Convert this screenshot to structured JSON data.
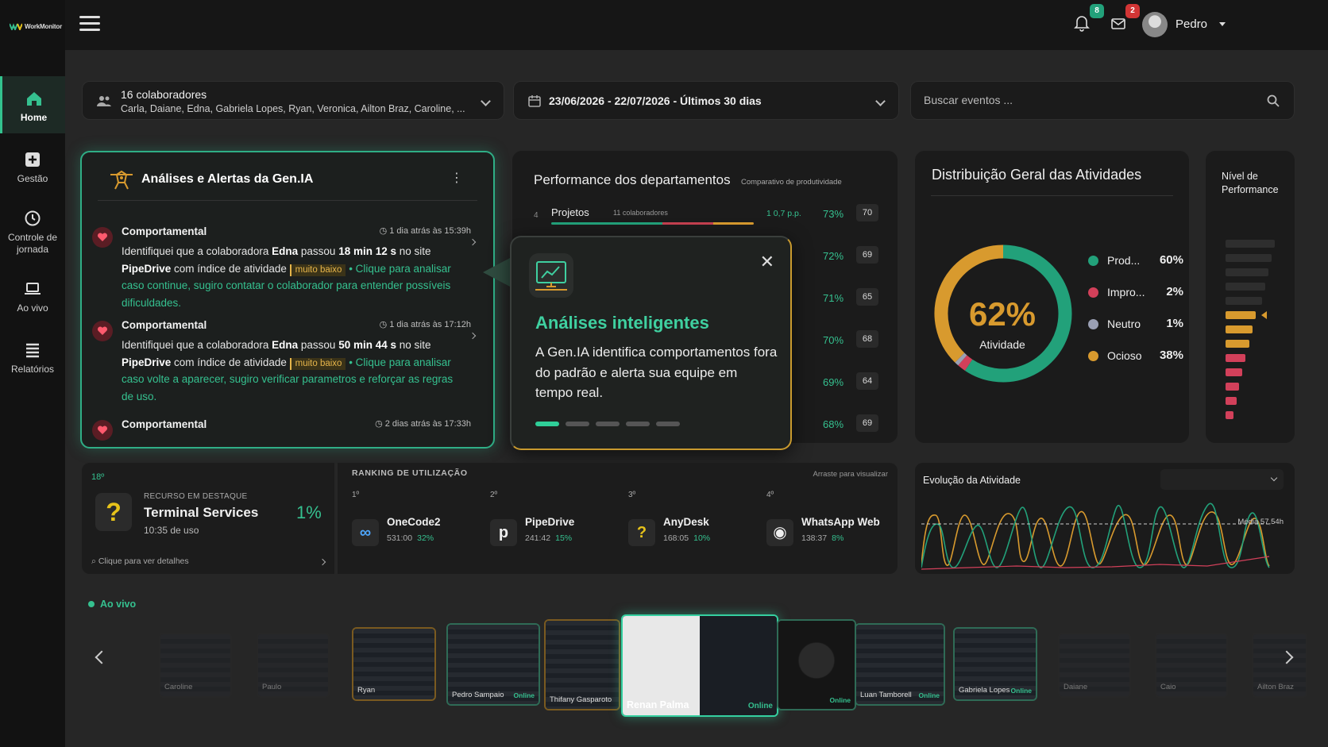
{
  "app": {
    "logo_text": "WorkMonitor"
  },
  "sidebar": {
    "items": [
      {
        "label": "Home",
        "icon": "home-icon",
        "active": true
      },
      {
        "label": "Gestão",
        "icon": "plus-square-icon"
      },
      {
        "label": "Controle de jornada",
        "icon": "clock-icon"
      },
      {
        "label": "Ao vivo",
        "icon": "laptop-icon"
      },
      {
        "label": "Relatórios",
        "icon": "list-icon"
      }
    ]
  },
  "header": {
    "notifications_count": "8",
    "messages_count": "2",
    "user_name": "Pedro"
  },
  "filters": {
    "people_title": "16 colaboradores",
    "people_list": "Carla, Daiane, Edna, Gabriela Lopes, Ryan, Veronica, Ailton Braz, Caroline, ...",
    "date_range": "23/06/2026 - 22/07/2026 - Últimos 30 dias",
    "search_placeholder": "Buscar eventos ..."
  },
  "ai_card": {
    "title": "Análises e Alertas da Gen.IA",
    "alerts": [
      {
        "category": "Comportamental",
        "time": "1 dia atrás às 15:39h",
        "t1": "Identifiquei que a colaboradora ",
        "name": "Edna",
        "t2": " passou ",
        "duration": "18 min 12 s",
        "t3": " no site ",
        "site": "PipeDrive",
        "t4": " com índice de atividade ",
        "tag": "muito baixo",
        "cta": "• Clique para analisar caso continue, sugiro contatar o colaborador para entender possíveis dificuldades."
      },
      {
        "category": "Comportamental",
        "time": "1 dia atrás às 17:12h",
        "t1": "Identifiquei que a colaboradora ",
        "name": "Edna",
        "t2": " passou ",
        "duration": "50 min 44 s",
        "t3": " no site ",
        "site": "PipeDrive",
        "t4": " com índice de atividade ",
        "tag": "muito baixo",
        "cta": "• Clique para analisar caso volte a aparecer, sugiro verificar parametros e reforçar as regras de uso."
      },
      {
        "category": "Comportamental",
        "time": "2 dias atrás às 17:33h"
      }
    ]
  },
  "performance": {
    "title": "Performance dos departamentos",
    "subtitle": "Comparativo de produtividade",
    "rows": [
      {
        "num": "4",
        "name": "Projetos",
        "count": "11 colaboradores",
        "pp": "1 0,7 p.p.",
        "pct": "73%",
        "score": "70"
      },
      {
        "pp": "p.",
        "pct": "72%",
        "score": "69"
      },
      {
        "pp": "p.",
        "pct": "71%",
        "score": "65"
      },
      {
        "pp": "p.",
        "pct": "70%",
        "score": "68"
      },
      {
        "pp": "p.",
        "pct": "69%",
        "score": "64"
      },
      {
        "pp": "p.",
        "pct": "68%",
        "score": "69"
      }
    ]
  },
  "popup": {
    "title": "Análises inteligentes",
    "text": "A Gen.IA identifica comportamentos fora do padrão e alerta sua equipe em tempo real.",
    "active_dot": 1,
    "dot_count": 5
  },
  "distribution": {
    "title": "Distribuição Geral das Atividades",
    "center_value": "62%",
    "center_label": "Atividade",
    "legend": [
      {
        "name": "Prod...",
        "pct": "60%",
        "value": 60,
        "color": "#22a17a"
      },
      {
        "name": "Impro...",
        "pct": "2%",
        "value": 2,
        "color": "#d2405a"
      },
      {
        "name": "Neutro",
        "pct": "1%",
        "value": 1,
        "color": "#9aa0b4"
      },
      {
        "name": "Ocioso",
        "pct": "38%",
        "value": 38,
        "color": "#d89a2e"
      }
    ]
  },
  "level": {
    "title": "Nível de Performance"
  },
  "highlight": {
    "rank": "18º",
    "caption": "RECURSO EM DESTAQUE",
    "name": "Terminal Services",
    "usage": "10:35 de uso",
    "pct": "1%",
    "link": "Clique para ver detalhes"
  },
  "ranking": {
    "title": "RANKING DE UTILIZAÇÃO",
    "hint": "Arraste para visualizar",
    "items": [
      {
        "pos": "1º",
        "name": "OneCode2",
        "time": "531:00",
        "pct": "32%",
        "icon": "infinity-icon",
        "glyph": "∞"
      },
      {
        "pos": "2º",
        "name": "PipeDrive",
        "time": "241:42",
        "pct": "15%",
        "icon": "pipedrive-icon",
        "glyph": "p"
      },
      {
        "pos": "3º",
        "name": "AnyDesk",
        "time": "168:05",
        "pct": "10%",
        "icon": "question-icon",
        "glyph": "?"
      },
      {
        "pos": "4º",
        "name": "WhatsApp Web",
        "time": "138:37",
        "pct": "8%",
        "icon": "globe-icon",
        "glyph": "◉"
      }
    ]
  },
  "evolution": {
    "title": "Evolução da Atividade",
    "avg_label": "Média 57,54h"
  },
  "live": {
    "label": "Ao vivo",
    "thumbs": [
      {
        "name": "Caroline",
        "online": ""
      },
      {
        "name": "Paulo",
        "online": ""
      },
      {
        "name": "Ryan",
        "online": ""
      },
      {
        "name": "Pedro Sampaio",
        "online": "Online"
      },
      {
        "name": "Thifany Gasparoto",
        "online": ""
      },
      {
        "name": "Renan Palma",
        "online": "Online"
      },
      {
        "name": "",
        "online": "Online"
      },
      {
        "name": "Luan Tamborell",
        "online": "Online"
      },
      {
        "name": "Gabriela Lopes",
        "online": "Online"
      },
      {
        "name": "Daiane",
        "online": ""
      },
      {
        "name": "Caio",
        "online": ""
      },
      {
        "name": "Ailton Braz",
        "online": ""
      }
    ]
  }
}
